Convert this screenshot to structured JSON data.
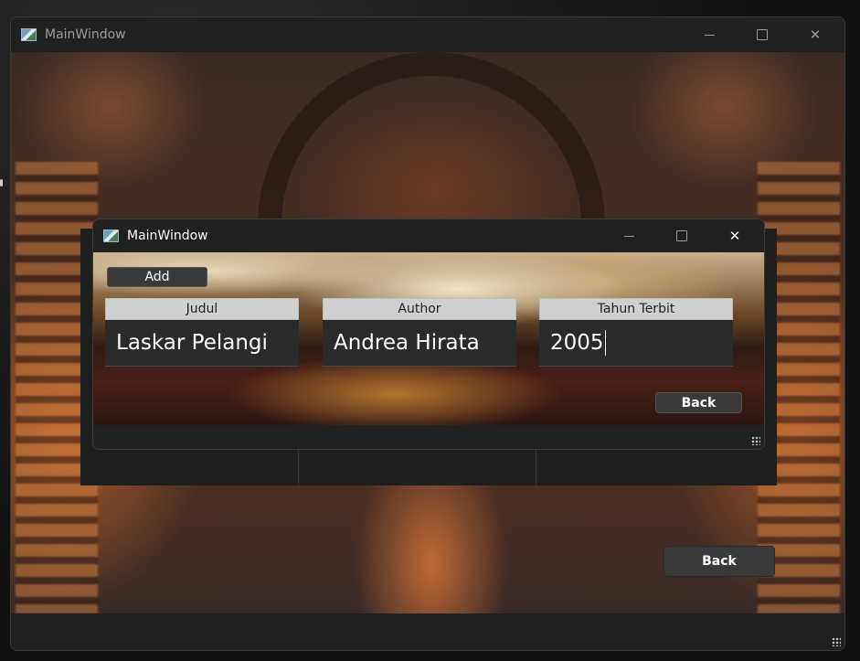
{
  "main_window": {
    "title": "MainWindow",
    "back_label": "Back",
    "controls": {
      "minimize": "minimize-icon",
      "maximize": "maximize-icon",
      "close": "close-icon"
    }
  },
  "dialog": {
    "title": "MainWindow",
    "add_label": "Add",
    "back_label": "Back",
    "fields": [
      {
        "label": "Judul",
        "value": "Laskar Pelangi"
      },
      {
        "label": "Author",
        "value": "Andrea Hirata"
      },
      {
        "label": "Tahun Terbit",
        "value": "2005"
      }
    ]
  },
  "colors": {
    "window_bg": "#202020",
    "button_bg": "#3a3a3a",
    "header_bg": "#d0d0d0",
    "input_bg": "#2a2a2a"
  }
}
